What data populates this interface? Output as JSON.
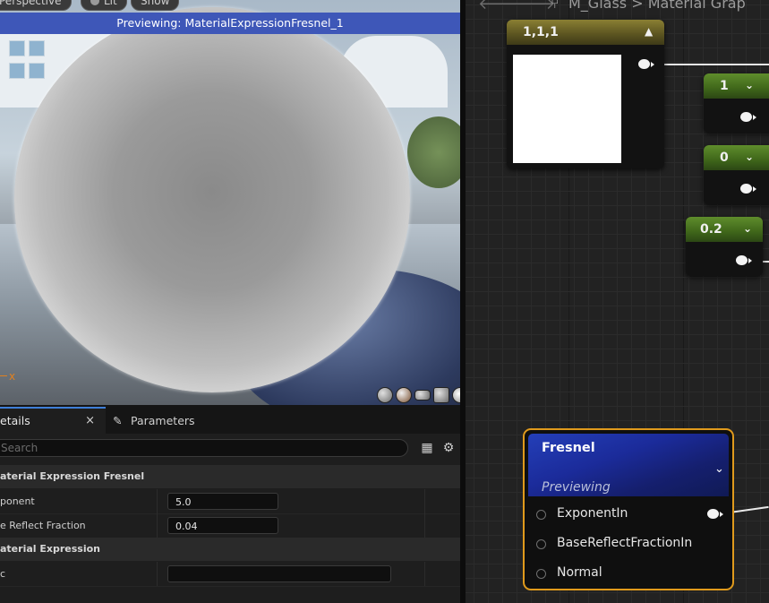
{
  "viewport": {
    "buttons": [
      "Perspective",
      "Lit",
      "Show"
    ],
    "banner": "Previewing: MaterialExpressionFresnel_1",
    "axis_label": "x",
    "preview_shapes": [
      "cylinder-icon",
      "sphere-icon",
      "plane-icon",
      "cube-icon",
      "teapot-icon"
    ]
  },
  "details": {
    "tab_details": "etails",
    "tab_close": "×",
    "tab_parameters": "Parameters",
    "search_placeholder": "Search",
    "category1": "aterial Expression Fresnel",
    "rows1": [
      {
        "name": "ponent",
        "value": "5.0"
      },
      {
        "name": "e Reflect Fraction",
        "value": "0.04"
      }
    ],
    "category2": "aterial Expression",
    "rows2": [
      {
        "name": "c",
        "value": ""
      }
    ]
  },
  "graph": {
    "breadcrumb": "M_Glass > Material Grap",
    "nodes": {
      "constant3": {
        "title": "1,1,1"
      },
      "const1": {
        "title": "1"
      },
      "const0": {
        "title": "0"
      },
      "const02": {
        "title": "0.2"
      }
    },
    "fresnel": {
      "title": "Fresnel",
      "status": "Previewing",
      "inputs": [
        "ExponentIn",
        "BaseReflectFractionIn",
        "Normal"
      ]
    }
  },
  "colors": {
    "banner": "#3e57b8",
    "selection_border": "#e09a1c",
    "fresnel_header": "#1b2b9a",
    "constant_header": "#3f661a",
    "vector_header": "#5a5320"
  }
}
